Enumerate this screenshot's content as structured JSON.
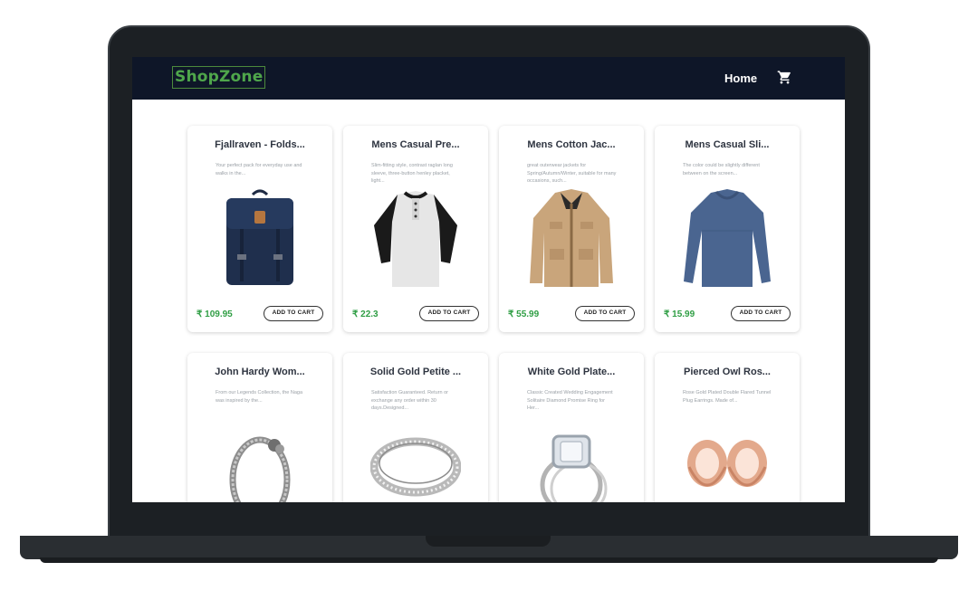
{
  "navbar": {
    "logo": "ShopZone",
    "home_link": "Home",
    "cart_icon": "cart-icon"
  },
  "products": [
    {
      "title": "Fjallraven - Folds...",
      "description": "Your perfect pack for everyday use and walks in the...",
      "price": "₹ 109.95",
      "button": "ADD TO CART",
      "icon": "backpack-icon"
    },
    {
      "title": "Mens Casual Pre...",
      "description": "Slim-fitting style, contrast raglan long sleeve, three-button henley placket, light...",
      "price": "₹ 22.3",
      "button": "ADD TO CART",
      "icon": "henley-shirt-icon"
    },
    {
      "title": "Mens Cotton Jac...",
      "description": "great outerwear jackets for Spring/Autumn/Winter, suitable for many occasions, such...",
      "price": "₹ 55.99",
      "button": "ADD TO CART",
      "icon": "jacket-icon"
    },
    {
      "title": "Mens Casual Sli...",
      "description": "The color could be slightly different between on the screen...",
      "price": "₹ 15.99",
      "button": "ADD TO CART",
      "icon": "long-sleeve-shirt-icon"
    },
    {
      "title": "John Hardy Wom...",
      "description": "From our Legends Collection, the Naga was inspired by the...",
      "price": "",
      "button": "",
      "icon": "bracelet-icon"
    },
    {
      "title": "Solid Gold Petite ...",
      "description": "Satisfaction Guaranteed. Return or exchange any order within 30 days.Designed...",
      "price": "",
      "button": "",
      "icon": "ring-band-icon"
    },
    {
      "title": "White Gold Plate...",
      "description": "Classic Created Wedding Engagement Solitaire Diamond Promise Ring for Her...",
      "price": "",
      "button": "",
      "icon": "diamond-ring-icon"
    },
    {
      "title": "Pierced Owl Ros...",
      "description": "Rose Gold Plated Double Flared Tunnel Plug Earrings. Made of...",
      "price": "",
      "button": "",
      "icon": "plug-earrings-icon"
    }
  ],
  "colors": {
    "navbar_bg": "#0e1628",
    "logo_green": "#4fa64b",
    "price_green": "#2f9e44"
  }
}
